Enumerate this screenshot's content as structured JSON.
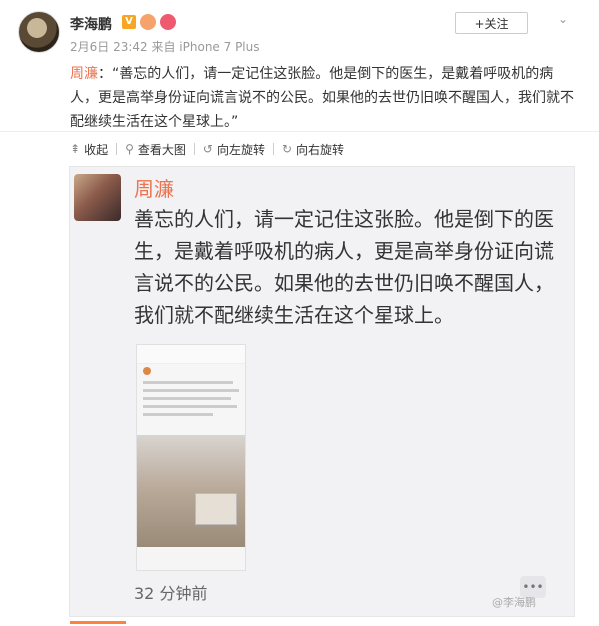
{
  "author": {
    "name": "李海鹏",
    "verified_badge": "V",
    "meta": "2月6日 23:42 来自 iPhone 7 Plus",
    "follow_label": "+关注"
  },
  "post": {
    "mention": "周濂",
    "text": "：“善忘的人们，请一定记住这张脸。他是倒下的医生，是戴着呼吸机的病人，更是高举身份证向谎言说不的公民。如果他的去世仍旧唤不醒国人，我们就不配继续生活在这个星球上。”"
  },
  "toolbar": {
    "collapse": "收起",
    "view_large": "查看大图",
    "rotate_left": "向左旋转",
    "rotate_right": "向右旋转"
  },
  "screenshot": {
    "name": "周濂",
    "text": "善忘的人们，请一定记住这张脸。他是倒下的医生，是戴着呼吸机的病人，更是高举身份证向谎言说不的公民。如果他的去世仍旧唤不醒国人，我们就不配继续生活在这个星球上。",
    "time_ago": "32 分钟前",
    "more": "•••"
  },
  "watermark": "@李海鹏",
  "colors": {
    "link": "#eb7350",
    "accent": "#ff8140"
  }
}
